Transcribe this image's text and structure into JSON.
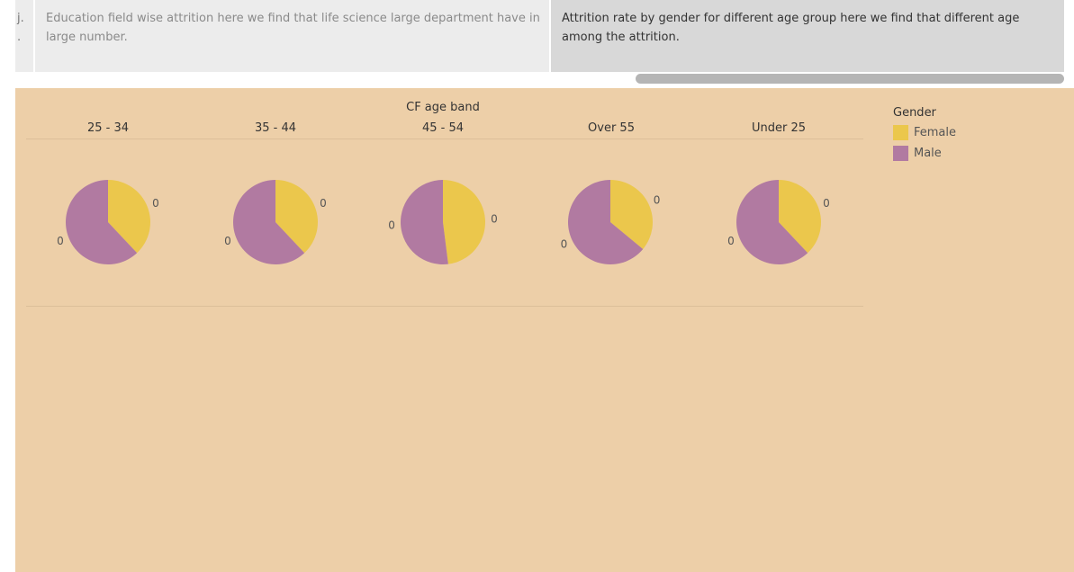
{
  "story": {
    "points": [
      {
        "text": "j.\n."
      },
      {
        "text": "Education field wise attrition here we find that life science large  department  have in large number."
      },
      {
        "text": "Attrition rate by gender for different age group here we find that different age among the attrition."
      }
    ]
  },
  "dashboard": {
    "column_header": "CF age band",
    "legend": {
      "title": "Gender",
      "items": [
        {
          "label": "Female",
          "color": "#ebc74c"
        },
        {
          "label": "Male",
          "color": "#b17aa1"
        }
      ]
    }
  },
  "chart_data": {
    "type": "pie",
    "title": "",
    "facet_by": "CF age band",
    "legend_placement": "right",
    "categories": [
      "Female",
      "Male"
    ],
    "colors": {
      "Female": "#ebc74c",
      "Male": "#b17aa1"
    },
    "facets": [
      {
        "band": "25 - 34",
        "values": [
          38,
          62
        ],
        "labels": [
          "0",
          "0"
        ]
      },
      {
        "band": "35 - 44",
        "values": [
          38,
          62
        ],
        "labels": [
          "0",
          "0"
        ]
      },
      {
        "band": "45 - 54",
        "values": [
          48,
          52
        ],
        "labels": [
          "0",
          "0"
        ]
      },
      {
        "band": "Over 55",
        "values": [
          36,
          64
        ],
        "labels": [
          "0",
          "0"
        ]
      },
      {
        "band": "Under 25",
        "values": [
          38,
          62
        ],
        "labels": [
          "0",
          "0"
        ]
      }
    ]
  }
}
